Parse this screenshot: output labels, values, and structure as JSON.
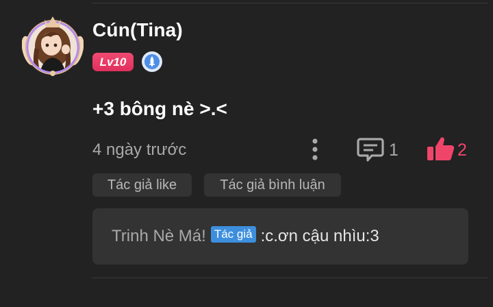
{
  "comment": {
    "username": "Cún(Tina)",
    "level": "Lv10",
    "content": "+3 bông nè >.<",
    "timestamp": "4 ngày trước",
    "comment_count": "1",
    "like_count": "2"
  },
  "tags": {
    "author_liked": "Tác giả like",
    "author_replied": "Tác giả bình luận"
  },
  "reply": {
    "name": "Trinh Nè Má!",
    "author_tag": "Tác giả",
    "separator": " : ",
    "text": "c.ơn cậu nhìu:3"
  },
  "colors": {
    "background": "#222222",
    "card": "#333333",
    "accent_like": "#f0456a",
    "level_badge": "#e0305c",
    "author_tag": "#3d8fdd"
  },
  "icons": [
    "avatar",
    "medal-icon",
    "more-icon",
    "comment-icon",
    "thumbs-up-icon"
  ]
}
